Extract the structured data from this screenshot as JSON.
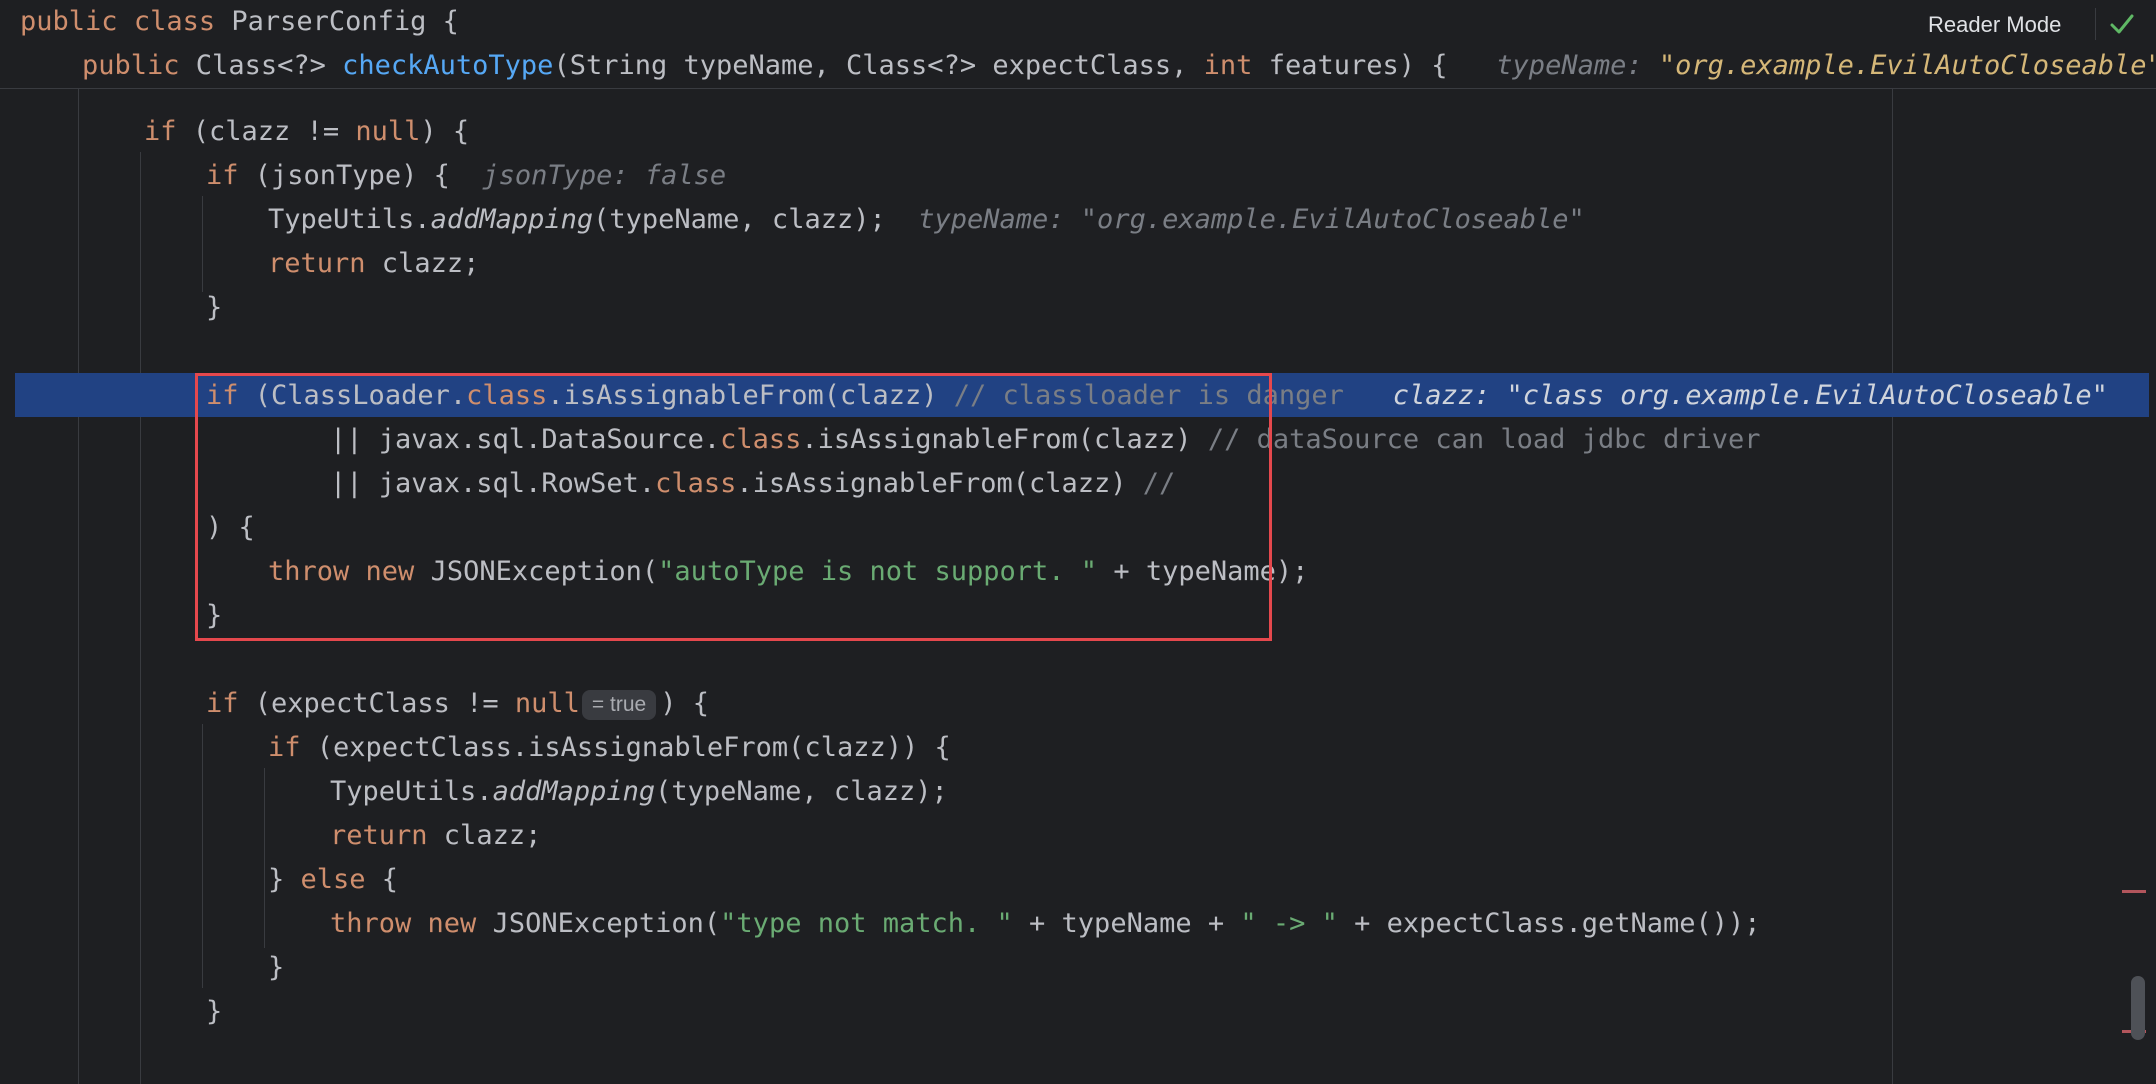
{
  "toolbar": {
    "reader_mode": "Reader Mode",
    "check_icon": "checkmark-icon"
  },
  "sticky": {
    "line1": {
      "kw1": "public",
      "kw2": "class",
      "name": "ParserConfig {"
    },
    "line2": {
      "kw1": "public",
      "t1": " Class<?> ",
      "method": "checkAutoType",
      "t2": "(String typeName, Class<?> expectClass, ",
      "kw2": "int",
      "t3": " features) {",
      "hint_label": "typeName: ",
      "hint_value": "\"org.example.EvilAutoCloseable\"",
      "hint_tail": "e"
    }
  },
  "code": {
    "l1": {
      "kw": "if",
      "t1": " (clazz != ",
      "kw2": "null",
      "t2": ") {"
    },
    "l2": {
      "kw": "if",
      "t1": " (jsonType) {",
      "hint": "jsonType: false"
    },
    "l3": {
      "t1": "TypeUtils.",
      "m": "addMapping",
      "t2": "(typeName, clazz);",
      "hint": "typeName: \"org.example.EvilAutoCloseable\""
    },
    "l4": {
      "kw": "return",
      "t1": " clazz;"
    },
    "l5": {
      "t1": "}"
    },
    "l6": {
      "kw": "if",
      "t1": " (ClassLoader.",
      "kw2": "class",
      "t2": ".isAssignableFrom(clazz) ",
      "cmt": "// classloader is danger",
      "hint": "clazz: \"class org.example.EvilAutoCloseable\""
    },
    "l7": {
      "t1": "|| javax.sql.DataSource.",
      "kw": "class",
      "t2": ".isAssignableFrom(clazz) ",
      "cmt": "// dataSource can load jdbc driver"
    },
    "l8": {
      "t1": "|| javax.sql.RowSet.",
      "kw": "class",
      "t2": ".isAssignableFrom(clazz) ",
      "cmt": "//"
    },
    "l9": {
      "t1": ") {"
    },
    "l10": {
      "kw": "throw",
      "kw2": "new",
      "t1": " JSONException(",
      "str": "\"autoType is not support. \"",
      "t2": " + typeName);"
    },
    "l11": {
      "t1": "}"
    },
    "l12": {
      "kw": "if",
      "t1": " (expectClass != ",
      "kw2": "null",
      "badge": "= true",
      "t2": ") {"
    },
    "l13": {
      "kw": "if",
      "t1": " (expectClass.isAssignableFrom(clazz)) {"
    },
    "l14": {
      "t1": "TypeUtils.",
      "m": "addMapping",
      "t2": "(typeName, clazz);"
    },
    "l15": {
      "kw": "return",
      "t1": " clazz;"
    },
    "l16": {
      "t1": "} ",
      "kw": "else",
      "t2": " {"
    },
    "l17": {
      "kw": "throw",
      "kw2": "new",
      "t1": " JSONException(",
      "str1": "\"type not match. \"",
      "t2": " + typeName + ",
      "str2": "\" -> \"",
      "t3": " + expectClass.getName());"
    },
    "l18": {
      "t1": "}"
    },
    "l19": {
      "t1": "}"
    }
  },
  "colors": {
    "background": "#1e1f22",
    "keyword": "#cf8e6d",
    "method": "#56a8f5",
    "string": "#6aab73",
    "comment": "#7a7e85",
    "execution_line": "#214283",
    "highlight_box": "#e5484d"
  }
}
